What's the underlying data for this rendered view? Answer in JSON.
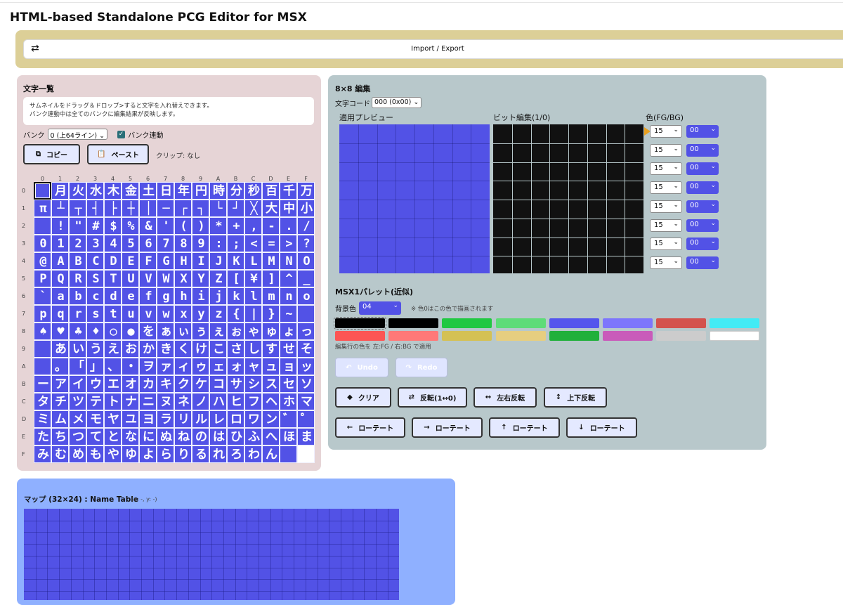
{
  "app": {
    "title": "HTML-based Standalone PCG Editor for MSX"
  },
  "io": {
    "icon": "swap-icon",
    "label": "Import / Export"
  },
  "chars": {
    "heading": "文字一覧",
    "hint1": "サムネイルをドラッグ＆ドロップ>すると文字を入れ替えできます。",
    "hint2": "バンク連動中は全てのバンクに編集結果が反映します。",
    "bank_label": "バンク",
    "bank_value": "0 (上64ライン)",
    "bank_link_label": "バンク連動",
    "copy_label": "コピー",
    "paste_label": "ペースト",
    "clip_text": "クリップ: なし",
    "col_headers": [
      "0",
      "1",
      "2",
      "3",
      "4",
      "5",
      "6",
      "7",
      "8",
      "9",
      "A",
      "B",
      "C",
      "D",
      "E",
      "F"
    ],
    "row_headers": [
      "0",
      "1",
      "2",
      "3",
      "4",
      "5",
      "6",
      "7",
      "8",
      "9",
      "A",
      "B",
      "C",
      "D",
      "E",
      "F"
    ],
    "glyphs": [
      "",
      "月",
      "火",
      "水",
      "木",
      "金",
      "土",
      "日",
      "年",
      "円",
      "時",
      "分",
      "秒",
      "百",
      "千",
      "万",
      "π",
      "┴",
      "┬",
      "┤",
      "├",
      "┼",
      "│",
      "─",
      "┌",
      "┐",
      "└",
      "┘",
      "╳",
      "大",
      "中",
      "小",
      "",
      "!",
      "\"",
      "#",
      "$",
      "%",
      "&",
      "'",
      "(",
      ")",
      "*",
      "+",
      ",",
      "-",
      ".",
      "/",
      "0",
      "1",
      "2",
      "3",
      "4",
      "5",
      "6",
      "7",
      "8",
      "9",
      ":",
      ";",
      "<",
      "=",
      ">",
      "?",
      "@",
      "A",
      "B",
      "C",
      "D",
      "E",
      "F",
      "G",
      "H",
      "I",
      "J",
      "K",
      "L",
      "M",
      "N",
      "O",
      "P",
      "Q",
      "R",
      "S",
      "T",
      "U",
      "V",
      "W",
      "X",
      "Y",
      "Z",
      "[",
      "¥",
      "]",
      "^",
      "_",
      "`",
      "a",
      "b",
      "c",
      "d",
      "e",
      "f",
      "g",
      "h",
      "i",
      "j",
      "k",
      "l",
      "m",
      "n",
      "o",
      "p",
      "q",
      "r",
      "s",
      "t",
      "u",
      "v",
      "w",
      "x",
      "y",
      "z",
      "{",
      "|",
      "}",
      "~",
      "",
      "♠",
      "♥",
      "♣",
      "♦",
      "○",
      "●",
      "を",
      "ぁ",
      "ぃ",
      "ぅ",
      "ぇ",
      "ぉ",
      "ゃ",
      "ゅ",
      "ょ",
      "っ",
      "",
      "あ",
      "い",
      "う",
      "え",
      "お",
      "か",
      "き",
      "く",
      "け",
      "こ",
      "さ",
      "し",
      "す",
      "せ",
      "そ",
      "",
      "。",
      "「",
      "」",
      "、",
      "・",
      "ヲ",
      "ァ",
      "ィ",
      "ゥ",
      "ェ",
      "ォ",
      "ャ",
      "ュ",
      "ョ",
      "ッ",
      "ー",
      "ア",
      "イ",
      "ウ",
      "エ",
      "オ",
      "カ",
      "キ",
      "ク",
      "ケ",
      "コ",
      "サ",
      "シ",
      "ス",
      "セ",
      "ソ",
      "タ",
      "チ",
      "ツ",
      "テ",
      "ト",
      "ナ",
      "ニ",
      "ヌ",
      "ネ",
      "ノ",
      "ハ",
      "ヒ",
      "フ",
      "ヘ",
      "ホ",
      "マ",
      "ミ",
      "ム",
      "メ",
      "モ",
      "ヤ",
      "ユ",
      "ヨ",
      "ラ",
      "リ",
      "ル",
      "レ",
      "ロ",
      "ワ",
      "ン",
      "゛",
      "゜",
      "た",
      "ち",
      "つ",
      "て",
      "と",
      "な",
      "に",
      "ぬ",
      "ね",
      "の",
      "は",
      "ひ",
      "ふ",
      "へ",
      "ほ",
      "ま",
      "み",
      "む",
      "め",
      "も",
      "や",
      "ゆ",
      "よ",
      "ら",
      "り",
      "る",
      "れ",
      "ろ",
      "わ",
      "ん",
      "",
      ""
    ]
  },
  "editor": {
    "heading": "8×8 編集",
    "code_label": "文字コード",
    "code_value": "000 (0x00)",
    "preview_label": "適用プレビュー",
    "bit_label": "ビット編集(1/0)",
    "color_label": "色(FG/BG)",
    "rows": [
      {
        "fg": "15",
        "bg": "00"
      },
      {
        "fg": "15",
        "bg": "00"
      },
      {
        "fg": "15",
        "bg": "00"
      },
      {
        "fg": "15",
        "bg": "00"
      },
      {
        "fg": "15",
        "bg": "00"
      },
      {
        "fg": "15",
        "bg": "00"
      },
      {
        "fg": "15",
        "bg": "00"
      },
      {
        "fg": "15",
        "bg": "00"
      }
    ],
    "palette_label": "MSX1パレット(近似)",
    "bg_label": "背景色",
    "bg_value": "04",
    "bg_note": "※ 色0はこの色で描画されます",
    "palette": [
      "#000000",
      "#000000",
      "#21c842",
      "#5edc78",
      "#5455ed",
      "#7d76fc",
      "#d4524d",
      "#42ebf5",
      "#fc5554",
      "#ff7978",
      "#d4c154",
      "#e6ce80",
      "#21b03b",
      "#c95bba",
      "#cccccc",
      "#ffffff"
    ],
    "palette_hint": "編集行の色を 左:FG / 右:BG で適用",
    "undo_label": "Undo",
    "redo_label": "Redo",
    "clear_label": "クリア",
    "invert_label": "反転(1↔0)",
    "flip_h_label": "左右反転",
    "flip_v_label": "上下反転",
    "rot_left_label": "ローテート",
    "rot_right_label": "ローテート",
    "rot_up_label": "ローテート",
    "rot_down_label": "ローテート"
  },
  "map": {
    "heading": "マップ (32×24) : Name Table",
    "coords": "(x: -, y: -)"
  }
}
